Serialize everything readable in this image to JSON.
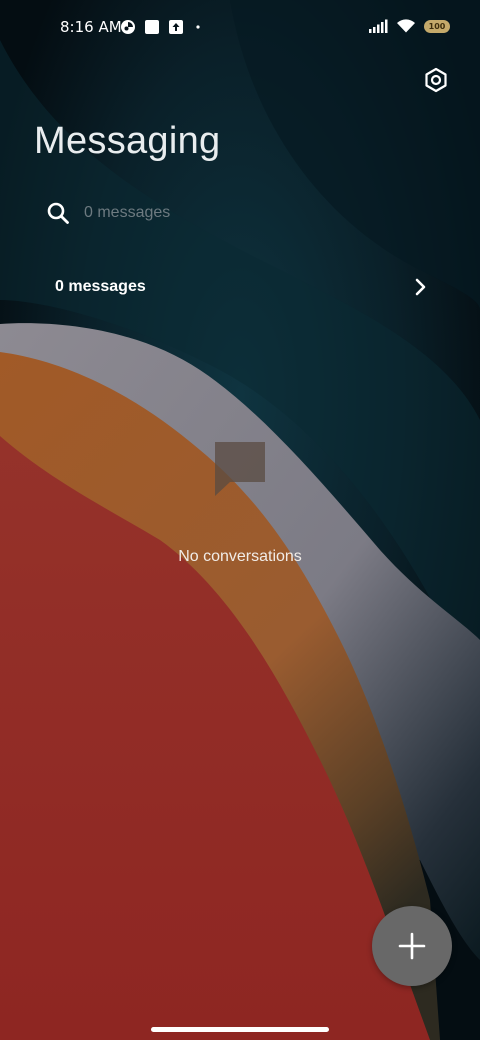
{
  "status_bar": {
    "time": "8:16 AM",
    "battery": "100",
    "icons_left": [
      "app-notification-icon",
      "square-notification-icon",
      "upload-notification-icon",
      "dot-icon"
    ],
    "icons_right": [
      "signal-icon",
      "wifi-icon",
      "battery-icon"
    ]
  },
  "header": {
    "title": "Messaging",
    "settings_icon": "settings-hexagon-icon"
  },
  "search": {
    "placeholder": "0 messages",
    "icon": "search-icon"
  },
  "folder": {
    "label": "0 messages",
    "icon": "chevron-right-icon"
  },
  "empty_state": {
    "icon": "message-bubble-icon",
    "text": "No conversations"
  },
  "fab": {
    "icon": "plus-icon"
  },
  "colors": {
    "background_dark": "#05121a",
    "teal_wave": "#0d2a33",
    "gray_wave": "#7c7b85",
    "orange_wave": "#9a5a2d",
    "red_wave": "#922e27",
    "fab": "#686868",
    "text_primary": "#ffffff",
    "text_placeholder": "#6d7a80"
  }
}
